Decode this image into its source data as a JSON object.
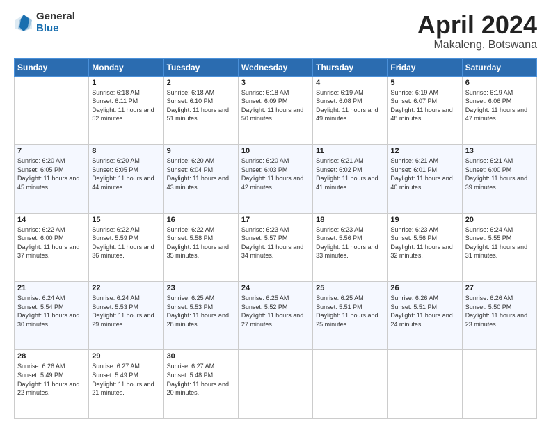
{
  "logo": {
    "general": "General",
    "blue": "Blue"
  },
  "header": {
    "month": "April 2024",
    "location": "Makaleng, Botswana"
  },
  "weekdays": [
    "Sunday",
    "Monday",
    "Tuesday",
    "Wednesday",
    "Thursday",
    "Friday",
    "Saturday"
  ],
  "weeks": [
    [
      {
        "day": "",
        "sunrise": "",
        "sunset": "",
        "daylight": ""
      },
      {
        "day": "1",
        "sunrise": "Sunrise: 6:18 AM",
        "sunset": "Sunset: 6:11 PM",
        "daylight": "Daylight: 11 hours and 52 minutes."
      },
      {
        "day": "2",
        "sunrise": "Sunrise: 6:18 AM",
        "sunset": "Sunset: 6:10 PM",
        "daylight": "Daylight: 11 hours and 51 minutes."
      },
      {
        "day": "3",
        "sunrise": "Sunrise: 6:18 AM",
        "sunset": "Sunset: 6:09 PM",
        "daylight": "Daylight: 11 hours and 50 minutes."
      },
      {
        "day": "4",
        "sunrise": "Sunrise: 6:19 AM",
        "sunset": "Sunset: 6:08 PM",
        "daylight": "Daylight: 11 hours and 49 minutes."
      },
      {
        "day": "5",
        "sunrise": "Sunrise: 6:19 AM",
        "sunset": "Sunset: 6:07 PM",
        "daylight": "Daylight: 11 hours and 48 minutes."
      },
      {
        "day": "6",
        "sunrise": "Sunrise: 6:19 AM",
        "sunset": "Sunset: 6:06 PM",
        "daylight": "Daylight: 11 hours and 47 minutes."
      }
    ],
    [
      {
        "day": "7",
        "sunrise": "Sunrise: 6:20 AM",
        "sunset": "Sunset: 6:05 PM",
        "daylight": "Daylight: 11 hours and 45 minutes."
      },
      {
        "day": "8",
        "sunrise": "Sunrise: 6:20 AM",
        "sunset": "Sunset: 6:05 PM",
        "daylight": "Daylight: 11 hours and 44 minutes."
      },
      {
        "day": "9",
        "sunrise": "Sunrise: 6:20 AM",
        "sunset": "Sunset: 6:04 PM",
        "daylight": "Daylight: 11 hours and 43 minutes."
      },
      {
        "day": "10",
        "sunrise": "Sunrise: 6:20 AM",
        "sunset": "Sunset: 6:03 PM",
        "daylight": "Daylight: 11 hours and 42 minutes."
      },
      {
        "day": "11",
        "sunrise": "Sunrise: 6:21 AM",
        "sunset": "Sunset: 6:02 PM",
        "daylight": "Daylight: 11 hours and 41 minutes."
      },
      {
        "day": "12",
        "sunrise": "Sunrise: 6:21 AM",
        "sunset": "Sunset: 6:01 PM",
        "daylight": "Daylight: 11 hours and 40 minutes."
      },
      {
        "day": "13",
        "sunrise": "Sunrise: 6:21 AM",
        "sunset": "Sunset: 6:00 PM",
        "daylight": "Daylight: 11 hours and 39 minutes."
      }
    ],
    [
      {
        "day": "14",
        "sunrise": "Sunrise: 6:22 AM",
        "sunset": "Sunset: 6:00 PM",
        "daylight": "Daylight: 11 hours and 37 minutes."
      },
      {
        "day": "15",
        "sunrise": "Sunrise: 6:22 AM",
        "sunset": "Sunset: 5:59 PM",
        "daylight": "Daylight: 11 hours and 36 minutes."
      },
      {
        "day": "16",
        "sunrise": "Sunrise: 6:22 AM",
        "sunset": "Sunset: 5:58 PM",
        "daylight": "Daylight: 11 hours and 35 minutes."
      },
      {
        "day": "17",
        "sunrise": "Sunrise: 6:23 AM",
        "sunset": "Sunset: 5:57 PM",
        "daylight": "Daylight: 11 hours and 34 minutes."
      },
      {
        "day": "18",
        "sunrise": "Sunrise: 6:23 AM",
        "sunset": "Sunset: 5:56 PM",
        "daylight": "Daylight: 11 hours and 33 minutes."
      },
      {
        "day": "19",
        "sunrise": "Sunrise: 6:23 AM",
        "sunset": "Sunset: 5:56 PM",
        "daylight": "Daylight: 11 hours and 32 minutes."
      },
      {
        "day": "20",
        "sunrise": "Sunrise: 6:24 AM",
        "sunset": "Sunset: 5:55 PM",
        "daylight": "Daylight: 11 hours and 31 minutes."
      }
    ],
    [
      {
        "day": "21",
        "sunrise": "Sunrise: 6:24 AM",
        "sunset": "Sunset: 5:54 PM",
        "daylight": "Daylight: 11 hours and 30 minutes."
      },
      {
        "day": "22",
        "sunrise": "Sunrise: 6:24 AM",
        "sunset": "Sunset: 5:53 PM",
        "daylight": "Daylight: 11 hours and 29 minutes."
      },
      {
        "day": "23",
        "sunrise": "Sunrise: 6:25 AM",
        "sunset": "Sunset: 5:53 PM",
        "daylight": "Daylight: 11 hours and 28 minutes."
      },
      {
        "day": "24",
        "sunrise": "Sunrise: 6:25 AM",
        "sunset": "Sunset: 5:52 PM",
        "daylight": "Daylight: 11 hours and 27 minutes."
      },
      {
        "day": "25",
        "sunrise": "Sunrise: 6:25 AM",
        "sunset": "Sunset: 5:51 PM",
        "daylight": "Daylight: 11 hours and 25 minutes."
      },
      {
        "day": "26",
        "sunrise": "Sunrise: 6:26 AM",
        "sunset": "Sunset: 5:51 PM",
        "daylight": "Daylight: 11 hours and 24 minutes."
      },
      {
        "day": "27",
        "sunrise": "Sunrise: 6:26 AM",
        "sunset": "Sunset: 5:50 PM",
        "daylight": "Daylight: 11 hours and 23 minutes."
      }
    ],
    [
      {
        "day": "28",
        "sunrise": "Sunrise: 6:26 AM",
        "sunset": "Sunset: 5:49 PM",
        "daylight": "Daylight: 11 hours and 22 minutes."
      },
      {
        "day": "29",
        "sunrise": "Sunrise: 6:27 AM",
        "sunset": "Sunset: 5:49 PM",
        "daylight": "Daylight: 11 hours and 21 minutes."
      },
      {
        "day": "30",
        "sunrise": "Sunrise: 6:27 AM",
        "sunset": "Sunset: 5:48 PM",
        "daylight": "Daylight: 11 hours and 20 minutes."
      },
      {
        "day": "",
        "sunrise": "",
        "sunset": "",
        "daylight": ""
      },
      {
        "day": "",
        "sunrise": "",
        "sunset": "",
        "daylight": ""
      },
      {
        "day": "",
        "sunrise": "",
        "sunset": "",
        "daylight": ""
      },
      {
        "day": "",
        "sunrise": "",
        "sunset": "",
        "daylight": ""
      }
    ]
  ]
}
